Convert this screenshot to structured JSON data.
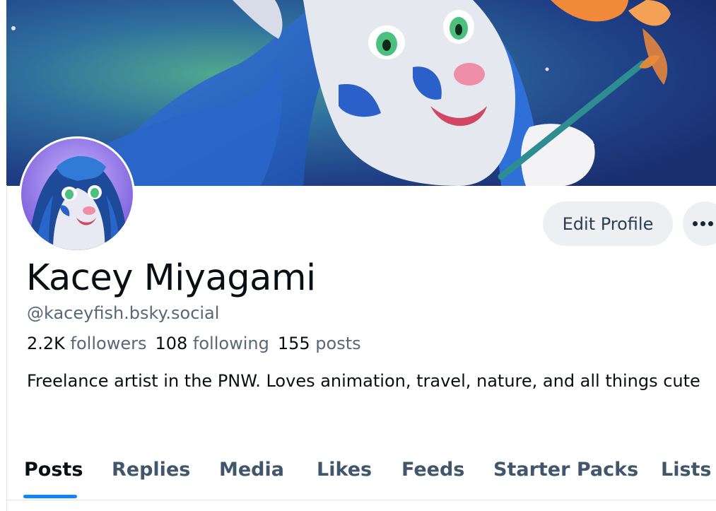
{
  "profile": {
    "display_name": "Kacey Miyagami",
    "handle": "@kaceyfish.bsky.social",
    "bio": "Freelance artist in the PNW. Loves animation, travel, nature, and all things cute"
  },
  "stats": {
    "followers_count": "2.2K",
    "followers_label": "followers",
    "following_count": "108",
    "following_label": "following",
    "posts_count": "155",
    "posts_label": "posts"
  },
  "actions": {
    "edit_profile_label": "Edit Profile",
    "more_icon": "more-horizontal-icon"
  },
  "tabs": [
    {
      "label": "Posts",
      "active": true
    },
    {
      "label": "Replies",
      "active": false
    },
    {
      "label": "Media",
      "active": false
    },
    {
      "label": "Likes",
      "active": false
    },
    {
      "label": "Feeds",
      "active": false
    },
    {
      "label": "Starter Packs",
      "active": false
    },
    {
      "label": "Lists",
      "active": false
    }
  ],
  "colors": {
    "accent": "#1083fe",
    "text_primary": "#0b0f14",
    "text_secondary": "#5a6776",
    "tab_inactive": "#42566b",
    "button_bg": "#edf0f3"
  }
}
